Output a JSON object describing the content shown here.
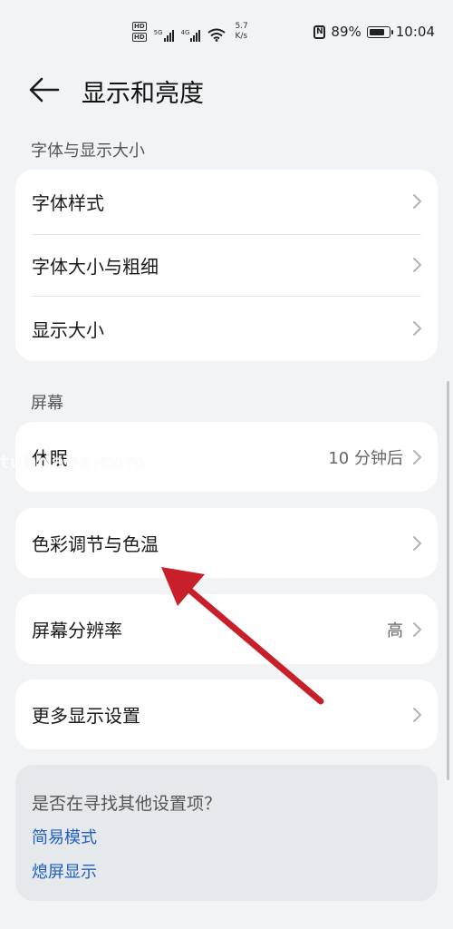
{
  "status_bar": {
    "hd1": "HD",
    "hd2": "HD",
    "net1": "5G",
    "net2": "4G",
    "speed_value": "5.7",
    "speed_unit": "K/s",
    "nfc": "N",
    "battery": "89%",
    "time": "10:04",
    "icons": [
      "hd-icon",
      "signal-icon",
      "wifi-icon",
      "nfc-icon",
      "battery-icon"
    ]
  },
  "header": {
    "title": "显示和亮度",
    "back_icon": "arrow-left-icon"
  },
  "sections": [
    {
      "label": "字体与显示大小",
      "items": [
        {
          "label": "字体样式"
        },
        {
          "label": "字体大小与粗细"
        },
        {
          "label": "显示大小"
        }
      ]
    },
    {
      "label": "屏幕",
      "items": [
        {
          "label": "休眠",
          "value": "10 分钟后"
        },
        {
          "label": "色彩调节与色温"
        },
        {
          "label": "屏幕分辨率",
          "value": "高"
        },
        {
          "label": "更多显示设置"
        }
      ]
    }
  ],
  "search": {
    "title": "是否在寻找其他设置项？",
    "links": [
      "简易模式",
      "熄屏显示"
    ]
  },
  "watermark": "tuhdaba.com",
  "colors": {
    "background": "#f1f3f5",
    "card": "#ffffff",
    "link": "#1f5fc4",
    "arrow": "#c8202a"
  }
}
